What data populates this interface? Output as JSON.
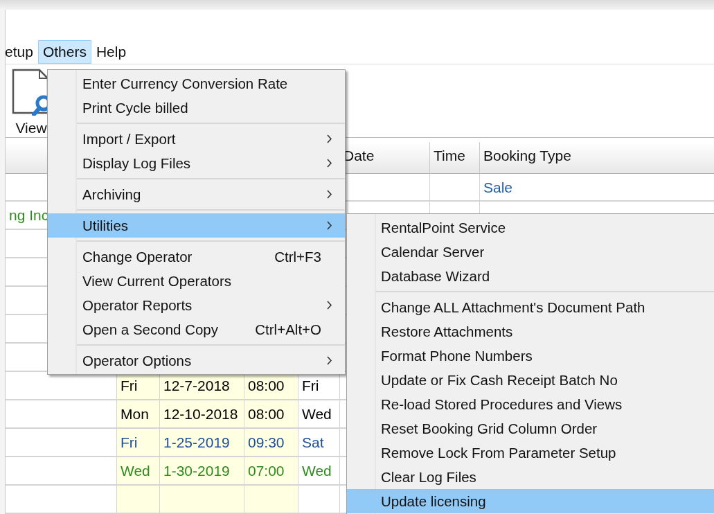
{
  "menu_bar": [
    {
      "label": "etup",
      "selected": false
    },
    {
      "label": "Others",
      "selected": true
    },
    {
      "label": "Help",
      "selected": false
    }
  ],
  "toolbar": [
    {
      "label": "View"
    }
  ],
  "grid": {
    "header": {
      "date": "Date",
      "time": "Time",
      "booking_type": "Booking Type"
    },
    "rows": [
      {
        "color": "#1f5fa8",
        "cells": {
          "booking_type": "Sale"
        }
      },
      {
        "color": "#2e8b1e",
        "cells": {
          "column_1": "ng Inc"
        }
      },
      {
        "cells": {}
      },
      {
        "cells": {}
      },
      {
        "cells": {}
      },
      {
        "cells": {}
      },
      {
        "cells": {}
      },
      {
        "color": "#000000",
        "cells": {
          "day": "Fri",
          "date": "12-7-2018",
          "time": "08:00",
          "day_2": "Fri"
        }
      },
      {
        "color": "#000000",
        "cells": {
          "day": "Mon",
          "date": "12-10-2018",
          "time": "08:00",
          "day_2": "Wed"
        }
      },
      {
        "color": "#1f4e99",
        "cells": {
          "day": "Fri",
          "date": "1-25-2019",
          "time": "09:30",
          "day_2": "Sat"
        }
      },
      {
        "color": "#2e8b1e",
        "cells": {
          "day": "Wed",
          "date": "1-30-2019",
          "time": "07:00",
          "day_2": "Wed"
        }
      },
      {
        "cells": {}
      }
    ]
  },
  "others_menu": {
    "items": [
      {
        "kind": "item",
        "label": "Enter Currency Conversion Rate",
        "submenu": false,
        "selected": false
      },
      {
        "kind": "item",
        "label": "Print Cycle billed",
        "submenu": false,
        "selected": false
      },
      {
        "kind": "separator"
      },
      {
        "kind": "item",
        "label": "Import / Export",
        "submenu": true,
        "selected": false
      },
      {
        "kind": "item",
        "label": "Display Log Files",
        "submenu": true,
        "selected": false
      },
      {
        "kind": "separator"
      },
      {
        "kind": "item",
        "label": "Archiving",
        "submenu": true,
        "selected": false
      },
      {
        "kind": "separator"
      },
      {
        "kind": "item",
        "label": "Utilities",
        "submenu": true,
        "selected": true
      },
      {
        "kind": "separator"
      },
      {
        "kind": "item",
        "label": "Change Operator",
        "shortcut": "Ctrl+F3",
        "submenu": false,
        "selected": false
      },
      {
        "kind": "item",
        "label": "View Current Operators",
        "submenu": false,
        "selected": false
      },
      {
        "kind": "item",
        "label": "Operator Reports",
        "submenu": true,
        "selected": false
      },
      {
        "kind": "item",
        "label": "Open a Second Copy",
        "shortcut": "Ctrl+Alt+O",
        "submenu": false,
        "selected": false
      },
      {
        "kind": "separator"
      },
      {
        "kind": "item",
        "label": "Operator Options",
        "submenu": true,
        "selected": false
      }
    ]
  },
  "utilities_menu": {
    "items": [
      {
        "kind": "item",
        "label": "RentalPoint Service",
        "submenu": false,
        "selected": false
      },
      {
        "kind": "item",
        "label": "Calendar Server",
        "submenu": false,
        "selected": false
      },
      {
        "kind": "item",
        "label": "Database Wizard",
        "submenu": false,
        "selected": false
      },
      {
        "kind": "separator"
      },
      {
        "kind": "item",
        "label": "Change ALL Attachment's Document Path",
        "submenu": false,
        "selected": false
      },
      {
        "kind": "item",
        "label": "Restore Attachments",
        "submenu": false,
        "selected": false
      },
      {
        "kind": "item",
        "label": "Format Phone Numbers",
        "submenu": false,
        "selected": false
      },
      {
        "kind": "item",
        "label": "Update or Fix Cash Receipt Batch No",
        "submenu": false,
        "selected": false
      },
      {
        "kind": "item",
        "label": "Re-load Stored Procedures and Views",
        "submenu": false,
        "selected": false
      },
      {
        "kind": "item",
        "label": "Reset Booking Grid Column Order",
        "submenu": false,
        "selected": false
      },
      {
        "kind": "item",
        "label": "Remove Lock From Parameter Setup",
        "submenu": false,
        "selected": false
      },
      {
        "kind": "item",
        "label": "Clear Log Files",
        "submenu": false,
        "selected": false
      },
      {
        "kind": "item",
        "label": "Update licensing",
        "submenu": false,
        "selected": true
      }
    ]
  }
}
